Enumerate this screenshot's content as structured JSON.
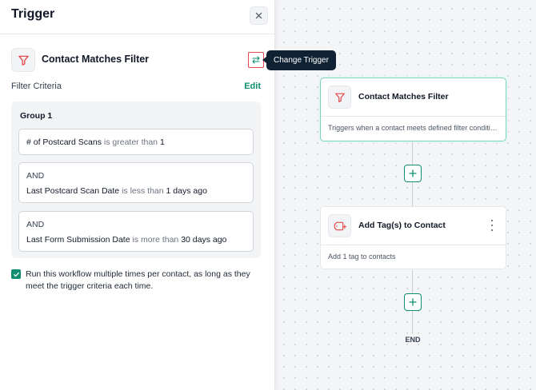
{
  "panel": {
    "title": "Trigger",
    "trigger_name": "Contact Matches Filter",
    "tooltip": "Change Trigger",
    "criteria_label": "Filter Criteria",
    "edit_label": "Edit",
    "group": {
      "title": "Group 1",
      "conditions": [
        {
          "connector": "",
          "field": "# of Postcard Scans",
          "operator": "is greater than",
          "value": "1"
        },
        {
          "connector": "AND",
          "field": "Last Postcard Scan Date",
          "operator": "is less than",
          "value": "1 days ago"
        },
        {
          "connector": "AND",
          "field": "Last Form Submission Date",
          "operator": "is more than",
          "value": "30 days ago"
        }
      ]
    },
    "rerun_checkbox": {
      "checked": true,
      "label": "Run this workflow multiple times per contact, as long as they meet the trigger criteria each time."
    }
  },
  "canvas": {
    "trigger_node": {
      "title": "Contact Matches Filter",
      "description": "Triggers when a contact meets defined filter conditions"
    },
    "action_node": {
      "title": "Add Tag(s) to Contact",
      "description": "Add 1 tag to contacts"
    },
    "end_label": "END"
  },
  "colors": {
    "accent": "#0f8f6f",
    "trigger_icon": "#e5484d",
    "tooltip_bg": "#0f2233",
    "node_highlight": "#7fd1c0"
  },
  "icons": {
    "close": "close-icon",
    "filter": "funnel-icon",
    "change_trigger": "swap-arrows-icon",
    "tag": "tag-plus-icon",
    "more": "kebab-menu-icon",
    "add": "plus-icon",
    "check": "checkmark-icon"
  }
}
